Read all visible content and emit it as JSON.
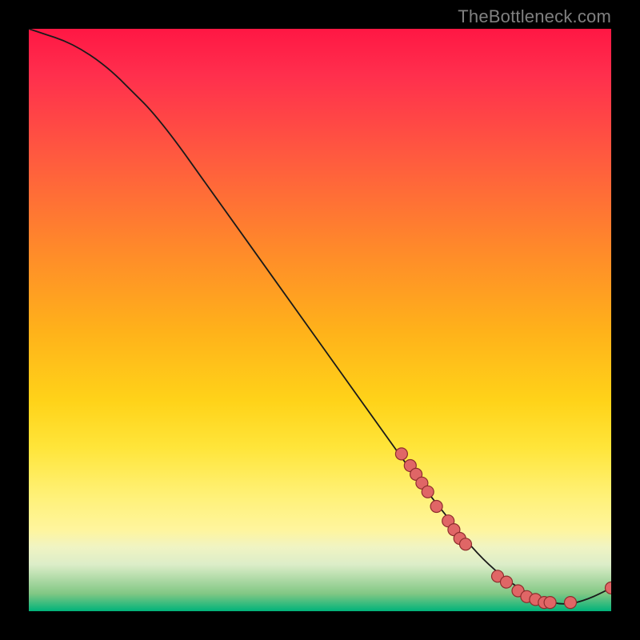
{
  "watermark": "TheBottleneck.com",
  "colors": {
    "background": "#000000",
    "curve": "#1a1a1a",
    "dot_fill": "#e06666",
    "dot_stroke": "#8e2d2d",
    "gradient_top": "#ff1744",
    "gradient_bottom": "#00b37a"
  },
  "chart_data": {
    "type": "line",
    "title": "",
    "xlabel": "",
    "ylabel": "",
    "xlim": [
      0,
      100
    ],
    "ylim": [
      0,
      100
    ],
    "grid": false,
    "series": [
      {
        "name": "bottleneck-curve",
        "x": [
          0,
          3,
          6,
          9,
          12,
          15,
          18,
          21,
          25,
          30,
          35,
          40,
          45,
          50,
          55,
          60,
          65,
          68,
          72,
          76,
          80,
          84,
          88,
          92,
          96,
          100
        ],
        "y": [
          100,
          99,
          98,
          96.5,
          94.5,
          92,
          89,
          86,
          81,
          74,
          67,
          60,
          53,
          46,
          39,
          32,
          25,
          21,
          16,
          11,
          7,
          4,
          2,
          1,
          2,
          4
        ],
        "comment": "y is plotted inverted (higher y = higher on screen). Curve starts top-left, descends to a flat minimum around x≈88, slight uptick at far right."
      }
    ],
    "markers": [
      {
        "x": 64,
        "y": 27
      },
      {
        "x": 65.5,
        "y": 25
      },
      {
        "x": 66.5,
        "y": 23.5
      },
      {
        "x": 67.5,
        "y": 22
      },
      {
        "x": 68.5,
        "y": 20.5
      },
      {
        "x": 70,
        "y": 18
      },
      {
        "x": 72,
        "y": 15.5
      },
      {
        "x": 73,
        "y": 14
      },
      {
        "x": 74,
        "y": 12.5
      },
      {
        "x": 75,
        "y": 11.5
      },
      {
        "x": 80.5,
        "y": 6
      },
      {
        "x": 82,
        "y": 5
      },
      {
        "x": 84,
        "y": 3.5
      },
      {
        "x": 85.5,
        "y": 2.5
      },
      {
        "x": 87,
        "y": 2
      },
      {
        "x": 88.5,
        "y": 1.5
      },
      {
        "x": 89.5,
        "y": 1.5
      },
      {
        "x": 93,
        "y": 1.5
      },
      {
        "x": 100,
        "y": 4
      }
    ]
  }
}
